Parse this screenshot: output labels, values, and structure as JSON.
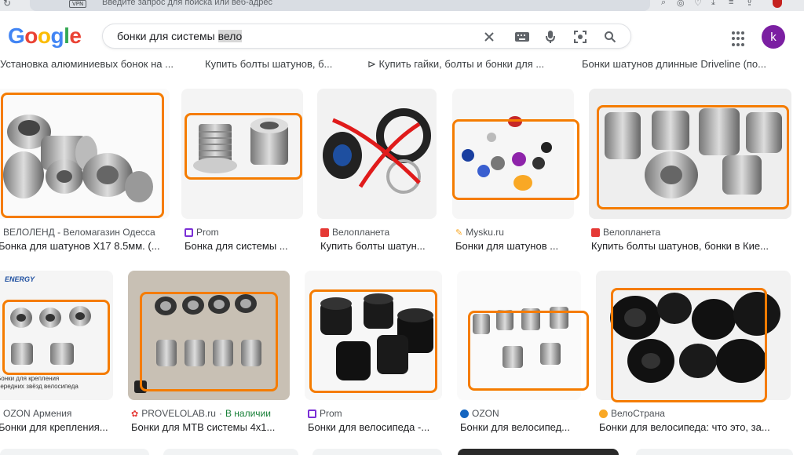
{
  "browser": {
    "vpn_label": "VPN",
    "omnibox_placeholder": "Введите запрос для поиска или веб-адрес"
  },
  "google": {
    "logo_letters": [
      "G",
      "o",
      "o",
      "g",
      "l",
      "e"
    ],
    "logo_colors": [
      "#4285F4",
      "#EA4335",
      "#FBBC05",
      "#4285F4",
      "#34A853",
      "#EA4335"
    ],
    "query_main": "бонки для системы ",
    "query_selected": "вело",
    "avatar_letter": "k"
  },
  "top_captions": [
    "Установка алюминиевых бонок на ...",
    "Купить болты шатунов, б...",
    "⊳ Купить гайки, болты и бонки для ...",
    "Бонки шатунов длинные Driveline (по..."
  ],
  "results_row1": [
    {
      "source": "ВЕЛОЛЕНД - Веломагазин Одесса",
      "title": "Бонка для шатунов X17 8.5мм. (...",
      "fav": "none",
      "fav_color": "#ffffff"
    },
    {
      "source": "Prom",
      "title": "Бонка для системы ...",
      "fav": "square",
      "fav_color": "#7b2fd6"
    },
    {
      "source": "Велопланета",
      "title": "Купить болты шатун...",
      "fav": "red",
      "fav_color": "#e53935"
    },
    {
      "source": "Mysku.ru",
      "title": "Бонки для шатунов ...",
      "fav": "pencil",
      "fav_color": "#f9a825"
    },
    {
      "source": "Велопланета",
      "title": "Купить болты шатунов, бонки в Кие...",
      "fav": "red",
      "fav_color": "#e53935"
    }
  ],
  "results_row2": [
    {
      "source": "OZON Армения",
      "title": "Бонки для крепления...",
      "fav": "none",
      "fav_color": "#ffffff",
      "available": ""
    },
    {
      "source": "PROVELOLAB.ru",
      "title": "Бонки для МТВ системы 4х1...",
      "fav": "gear",
      "fav_color": "#e53935",
      "available": "В наличии"
    },
    {
      "source": "Prom",
      "title": "Бонки для велосипеда -...",
      "fav": "square",
      "fav_color": "#7b2fd6",
      "available": ""
    },
    {
      "source": "OZON",
      "title": "Бонки для велосипед...",
      "fav": "ozon",
      "fav_color": "#1565c0",
      "available": ""
    },
    {
      "source": "ВелоСтрана",
      "title": "Бонки для велосипеда: что это, за...",
      "fav": "velo",
      "fav_color": "#f9a825",
      "available": ""
    }
  ],
  "image_text": {
    "energy_logo": "ENERGY",
    "energy_caption_1": "Бонки для крепления",
    "energy_caption_2": "передних звёзд велосипеда"
  },
  "colors": {
    "highlight": "#f57c00",
    "link_green": "#188038"
  }
}
